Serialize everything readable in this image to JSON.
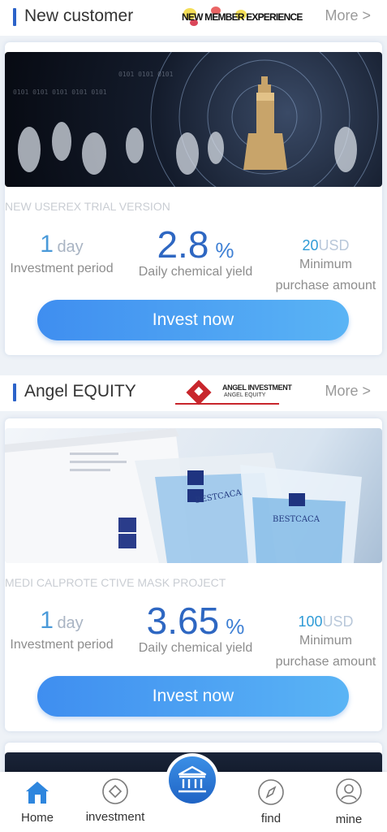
{
  "sections": [
    {
      "title": "New customer",
      "more": "More >",
      "logo_text": "NEW MEMBER EXPERIENCE",
      "project_name": "NEW USEREX TRIAL VERSION",
      "period_value": "1",
      "period_unit": "day",
      "period_label": "Investment period",
      "yield_value": "2.8",
      "yield_unit": "%",
      "yield_label": "Daily chemical yield",
      "min_value": "20",
      "min_unit": "USD",
      "min_label_1": "Minimum",
      "min_label_2": "purchase amount",
      "button": "Invest now"
    },
    {
      "title": "Angel EQUITY",
      "more": "More >",
      "logo_text_1": "ANGEL INVESTMENT",
      "logo_text_2": "ANGEL EQUITY",
      "project_name": "MEDI CALPROTE CTIVE MASK PROJECT",
      "period_value": "1",
      "period_unit": "day",
      "period_label": "Investment period",
      "yield_value": "3.65",
      "yield_unit": "%",
      "yield_label": "Daily chemical yield",
      "min_value": "100",
      "min_unit": "USD",
      "min_label_1": "Minimum",
      "min_label_2": "purchase amount",
      "button": "Invest now",
      "mask_text": "BESTCACA"
    }
  ],
  "tabbar": {
    "items": [
      {
        "label": "Home",
        "icon": "home-icon"
      },
      {
        "label": "investment",
        "icon": "diamond-icon"
      },
      {
        "label": "",
        "icon": "bank-icon"
      },
      {
        "label": "find",
        "icon": "compass-icon"
      },
      {
        "label": "mine",
        "icon": "user-icon"
      }
    ]
  },
  "colors": {
    "accent": "#2c63c9",
    "button": "#4a9ef2",
    "yield": "#2e67c2"
  }
}
